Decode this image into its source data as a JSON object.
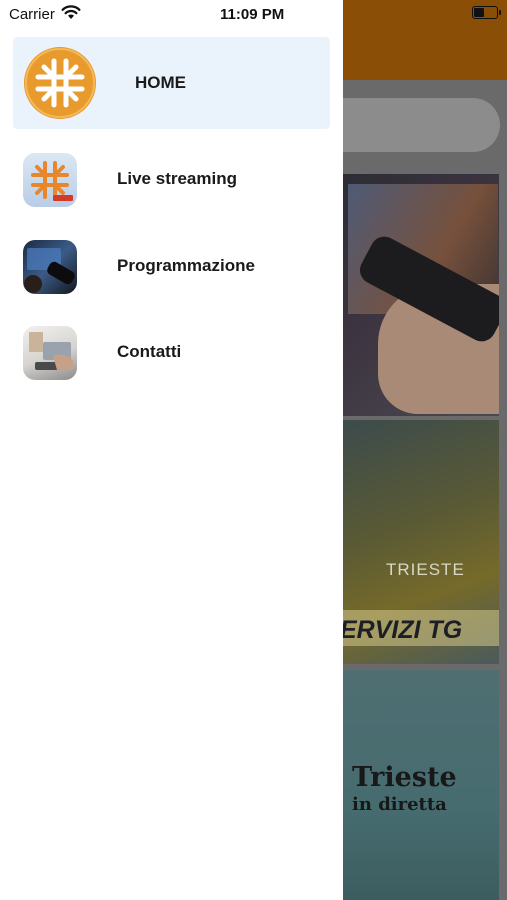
{
  "status_bar": {
    "carrier": "Carrier",
    "time": "11:09 PM"
  },
  "drawer": {
    "items": [
      {
        "label": "HOME",
        "icon": "home-logo-icon",
        "active": true
      },
      {
        "label": "Live streaming",
        "icon": "live-streaming-icon",
        "active": false
      },
      {
        "label": "Programmazione",
        "icon": "programmazione-icon",
        "active": false
      },
      {
        "label": "Contatti",
        "icon": "contatti-icon",
        "active": false
      }
    ]
  },
  "background": {
    "header_color": "#8a4e07",
    "cards": [
      {
        "name": "tv-remote-image"
      },
      {
        "name": "servizi-tg-image",
        "map_label": "TRIESTE",
        "banner": "ERVIZI TG"
      },
      {
        "name": "trieste-in-diretta-image",
        "title": "Trieste",
        "subtitle": "in diretta"
      }
    ]
  },
  "colors": {
    "accent_orange": "#e89a2c",
    "active_item_bg": "#eaf3fc",
    "drawer_bg": "#ffffff"
  }
}
